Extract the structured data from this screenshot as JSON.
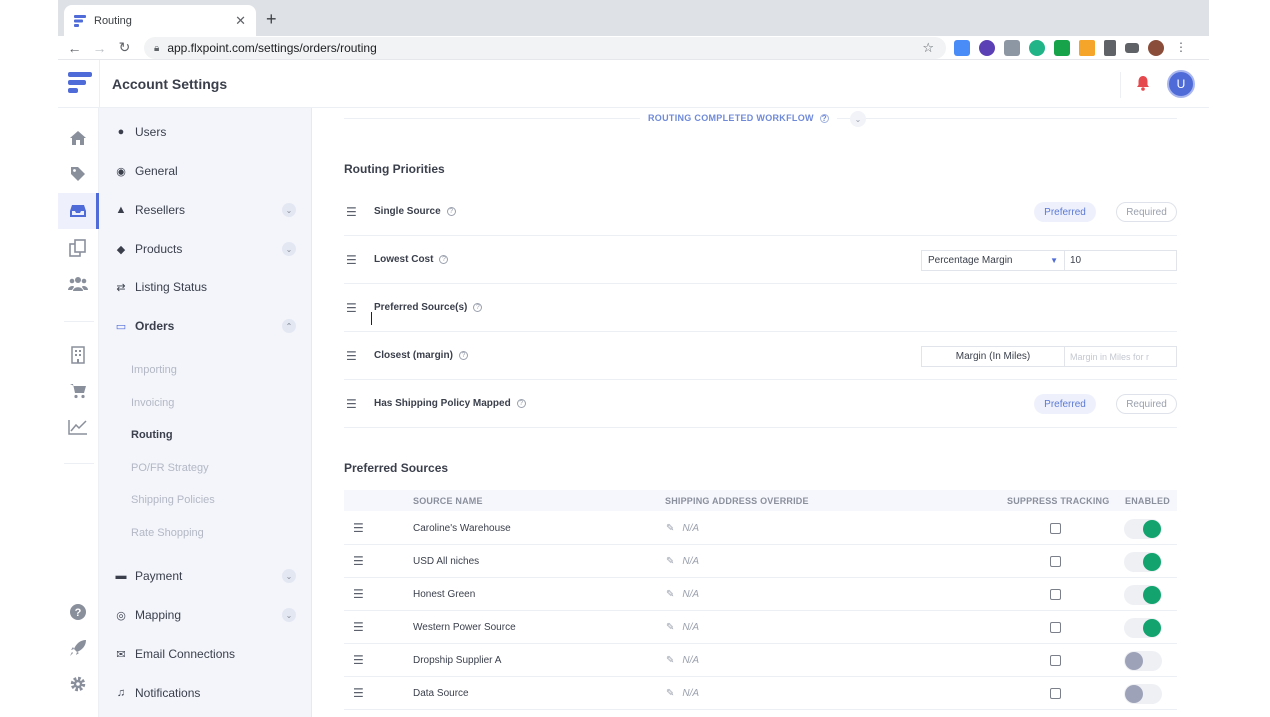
{
  "browser": {
    "tab_title": "Routing",
    "url": "app.flxpoint.com/settings/orders/routing"
  },
  "header": {
    "title": "Account Settings",
    "avatar_initial": "U"
  },
  "sidebar": {
    "items": [
      {
        "label": "Users",
        "icon": "user-circle-icon"
      },
      {
        "label": "General",
        "icon": "globe-icon"
      },
      {
        "label": "Resellers",
        "icon": "users-icon",
        "expandable": true
      },
      {
        "label": "Products",
        "icon": "tag-icon",
        "expandable": true
      },
      {
        "label": "Listing Status",
        "icon": "arrows-icon"
      },
      {
        "label": "Orders",
        "icon": "inbox-icon",
        "expanded": true
      },
      {
        "label": "Payment",
        "icon": "card-icon",
        "expandable": true
      },
      {
        "label": "Mapping",
        "icon": "mapping-icon",
        "expandable": true
      },
      {
        "label": "Email Connections",
        "icon": "envelope-icon"
      },
      {
        "label": "Notifications",
        "icon": "bell-icon"
      }
    ],
    "orders_sub": [
      "Importing",
      "Invoicing",
      "Routing",
      "PO/FR Strategy",
      "Shipping Policies",
      "Rate Shopping"
    ],
    "active_sub": "Routing"
  },
  "main": {
    "workflow_label": "ROUTING COMPLETED WORKFLOW",
    "priorities_title": "Routing Priorities",
    "priorities": [
      {
        "name": "Single Source",
        "control": "pills"
      },
      {
        "name": "Lowest Cost",
        "control": "select",
        "select_value": "Percentage Margin",
        "input_value": "10"
      },
      {
        "name": "Preferred Source(s)",
        "control": "none"
      },
      {
        "name": "Closest (margin)",
        "control": "button",
        "button_label": "Margin (In Miles)",
        "input_placeholder": "Margin in Miles for r"
      },
      {
        "name": "Has Shipping Policy Mapped",
        "control": "pills"
      }
    ],
    "pill_preferred": "Preferred",
    "pill_required": "Required",
    "sources_title": "Preferred Sources",
    "columns": {
      "source_name": "SOURCE NAME",
      "shipping_override": "SHIPPING ADDRESS OVERRIDE",
      "suppress_tracking": "SUPPRESS TRACKING",
      "enabled": "ENABLED"
    },
    "sources": [
      {
        "name": "Caroline's Warehouse",
        "override": "N/A",
        "suppress": false,
        "enabled": true
      },
      {
        "name": "USD All niches",
        "override": "N/A",
        "suppress": false,
        "enabled": true
      },
      {
        "name": "Honest Green",
        "override": "N/A",
        "suppress": false,
        "enabled": true
      },
      {
        "name": "Western Power Source",
        "override": "N/A",
        "suppress": false,
        "enabled": true
      },
      {
        "name": "Dropship Supplier A",
        "override": "N/A",
        "suppress": false,
        "enabled": false
      },
      {
        "name": "Data Source",
        "override": "N/A",
        "suppress": false,
        "enabled": false
      }
    ]
  },
  "colors": {
    "brand": "#4f6bd8",
    "toggle_on": "#12a36e",
    "toggle_off": "#9ea2b8",
    "bell": "#e5484d"
  }
}
